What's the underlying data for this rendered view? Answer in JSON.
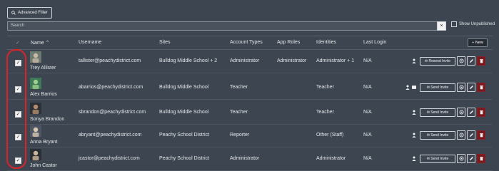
{
  "toolbar": {
    "advanced_filter_label": "Advanced Filter"
  },
  "search": {
    "placeholder": "Search",
    "clear_label": "×",
    "show_unpublished_label": "Show Unpublished"
  },
  "table": {
    "headers": {
      "select_all": "✓",
      "name": "Name ⌃",
      "username": "Username",
      "sites": "Sites",
      "account_types": "Account Types",
      "app_roles": "App Roles",
      "identities": "Identities",
      "last_login": "Last Login",
      "new_label": "+ New"
    },
    "rows": [
      {
        "checked": "✓",
        "name": "Trey Allister",
        "username": "tallister@peachydistrict.com",
        "sites": "Bulldog Middle School + 2",
        "account_type": "Administrator",
        "app_role": "Administrator",
        "identity": "Administrator + 1",
        "last_login": "N/A",
        "invite": "✉ Resend Invite"
      },
      {
        "checked": "✓",
        "name": "Alex Barrios",
        "username": "abarrios@peachydistrict.com",
        "sites": "Bulldog Middle School",
        "account_type": "Teacher",
        "app_role": "",
        "identity": "Teacher",
        "last_login": "N/A",
        "invite": "✉ Send Invite"
      },
      {
        "checked": "✓",
        "name": "Sonya Brandon",
        "username": "sbrandon@peachydistrict.com",
        "sites": "Bulldog Middle School",
        "account_type": "Teacher",
        "app_role": "",
        "identity": "Teacher",
        "last_login": "N/A",
        "invite": "✉ Send Invite"
      },
      {
        "checked": "✓",
        "name": "Anna Bryant",
        "username": "abryant@peachydistrict.com",
        "sites": "Peachy School District",
        "account_type": "Reporter",
        "app_role": "",
        "identity": "Other (Staff)",
        "last_login": "N/A",
        "invite": "✉ Send Invite"
      },
      {
        "checked": "✓",
        "name": "John Castor",
        "username": "jcastor@peachydistrict.com",
        "sites": "Peachy School District",
        "account_type": "Administrator",
        "app_role": "",
        "identity": "Administrator",
        "last_login": "N/A",
        "invite": "✉ Send Invite"
      }
    ]
  },
  "colors": {
    "background": "#3c4550",
    "highlight": "#d9242a",
    "delete": "#7a1a1e"
  },
  "icons": [
    "search-icon",
    "user-icon",
    "mail-icon",
    "gear-icon",
    "pencil-icon",
    "trash-icon"
  ]
}
